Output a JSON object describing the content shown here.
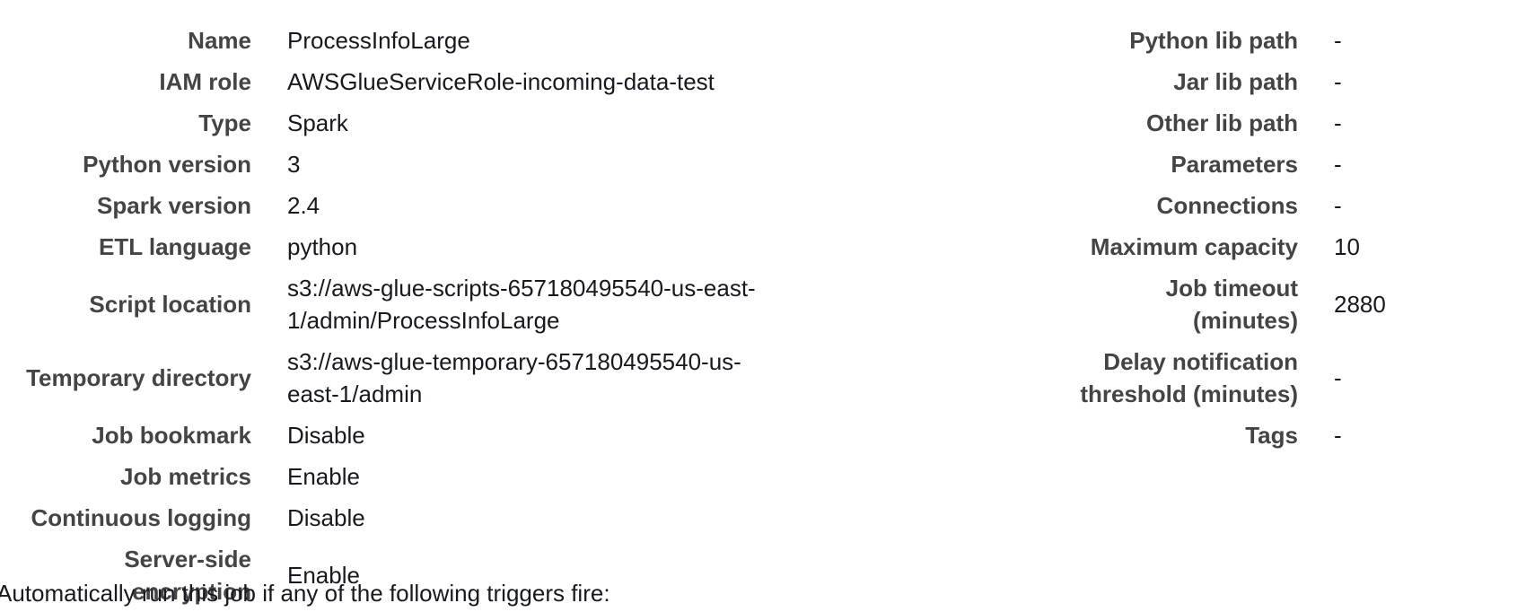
{
  "left_fields": [
    {
      "label": "Name",
      "value": "ProcessInfoLarge"
    },
    {
      "label": "IAM role",
      "value": "AWSGlueServiceRole-incoming-data-test"
    },
    {
      "label": "Type",
      "value": "Spark"
    },
    {
      "label": "Python version",
      "value": "3"
    },
    {
      "label": "Spark version",
      "value": "2.4"
    },
    {
      "label": "ETL language",
      "value": "python"
    },
    {
      "label": "Script location",
      "value": "s3://aws-glue-scripts-657180495540-us-east-1/admin/ProcessInfoLarge"
    },
    {
      "label": "Temporary directory",
      "value": "s3://aws-glue-temporary-657180495540-us-east-1/admin"
    },
    {
      "label": "Job bookmark",
      "value": "Disable"
    },
    {
      "label": "Job metrics",
      "value": "Enable"
    },
    {
      "label": "Continuous logging",
      "value": "Disable"
    },
    {
      "label": "Server-side encryption",
      "value": "Enable"
    }
  ],
  "right_fields": [
    {
      "label": "Python lib path",
      "value": "-"
    },
    {
      "label": "Jar lib path",
      "value": "-"
    },
    {
      "label": "Other lib path",
      "value": "-"
    },
    {
      "label": "Parameters",
      "value": "-"
    },
    {
      "label": "Connections",
      "value": "-"
    },
    {
      "label": "Maximum capacity",
      "value": "10"
    },
    {
      "label": "Job timeout (minutes)",
      "value": "2880"
    },
    {
      "label": "Delay notification threshold (minutes)",
      "value": "-"
    },
    {
      "label": "Tags",
      "value": "-"
    }
  ],
  "footer_text": "Automatically run this job if any of the following triggers fire:"
}
